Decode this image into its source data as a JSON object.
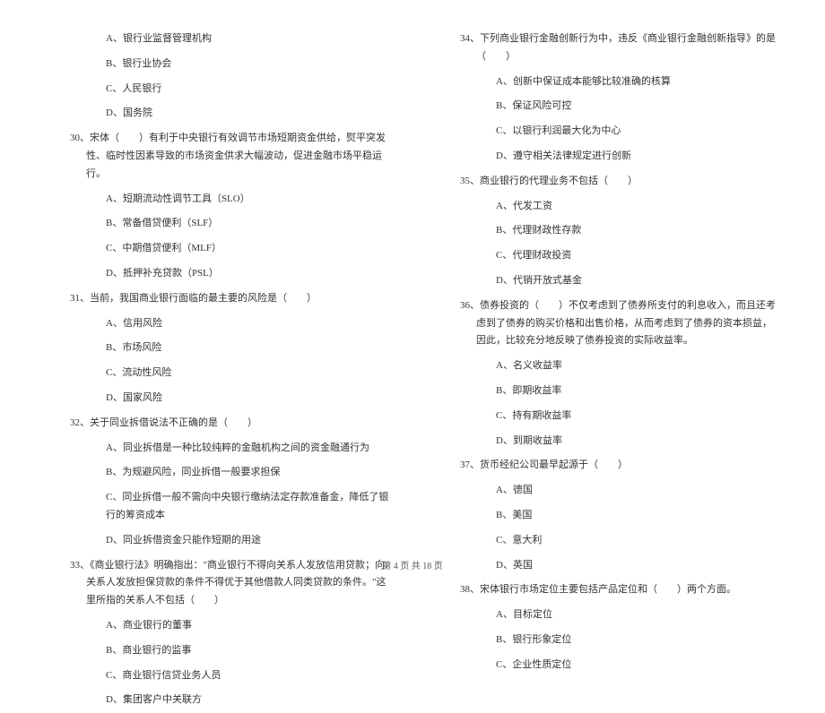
{
  "left_column": {
    "q29_options": {
      "a": "A、银行业监督管理机构",
      "b": "B、银行业协会",
      "c": "C、人民银行",
      "d": "D、国务院"
    },
    "q30": {
      "text": "30、宋体（　　）有利于中央银行有效调节市场短期资金供给，熨平突发性、临时性因素导致的市场资金供求大幅波动，促进金融市场平稳运行。",
      "a": "A、短期流动性调节工具（SLO）",
      "b": "B、常备借贷便利（SLF）",
      "c": "C、中期借贷便利（MLF）",
      "d": "D、抵押补充贷款（PSL）"
    },
    "q31": {
      "text": "31、当前，我国商业银行面临的最主要的风险是（　　）",
      "a": "A、信用风险",
      "b": "B、市场风险",
      "c": "C、流动性风险",
      "d": "D、国家风险"
    },
    "q32": {
      "text": "32、关于同业拆借说法不正确的是（　　）",
      "a": "A、同业拆借是一种比较纯粹的金融机构之间的资金融通行为",
      "b": "B、为规避风险，同业拆借一般要求担保",
      "c": "C、同业拆借一般不需向中央银行缴纳法定存款准备金，降低了银行的筹资成本",
      "d": "D、同业拆借资金只能作短期的用途"
    },
    "q33": {
      "text": "33、《商业银行法》明确指出：\"商业银行不得向关系人发放信用贷款；向关系人发放担保贷款的条件不得优于其他借款人同类贷款的条件。\"这里所指的关系人不包括（　　）",
      "a": "A、商业银行的董事",
      "b": "B、商业银行的监事",
      "c": "C、商业银行信贷业务人员",
      "d": "D、集团客户中关联方"
    }
  },
  "right_column": {
    "q34": {
      "text": "34、下列商业银行金融创新行为中，违反《商业银行金融创新指导》的是（　　）",
      "a": "A、创新中保证成本能够比较准确的核算",
      "b": "B、保证风险可控",
      "c": "C、以银行利润最大化为中心",
      "d": "D、遵守相关法律规定进行创新"
    },
    "q35": {
      "text": "35、商业银行的代理业务不包括（　　）",
      "a": "A、代发工资",
      "b": "B、代理财政性存款",
      "c": "C、代理财政投资",
      "d": "D、代销开放式基金"
    },
    "q36": {
      "text": "36、债券投资的（　　）不仅考虑到了债券所支付的利息收入，而且还考虑到了债券的购买价格和出售价格，从而考虑到了债券的资本损益，因此，比较充分地反映了债券投资的实际收益率。",
      "a": "A、名义收益率",
      "b": "B、即期收益率",
      "c": "C、持有期收益率",
      "d": "D、到期收益率"
    },
    "q37": {
      "text": "37、货币经纪公司最早起源于（　　）",
      "a": "A、德国",
      "b": "B、美国",
      "c": "C、意大利",
      "d": "D、英国"
    },
    "q38": {
      "text": "38、宋体银行市场定位主要包括产品定位和（　　）两个方面。",
      "a": "A、目标定位",
      "b": "B、银行形象定位",
      "c": "C、企业性质定位"
    }
  },
  "footer": "第 4 页 共 18 页"
}
